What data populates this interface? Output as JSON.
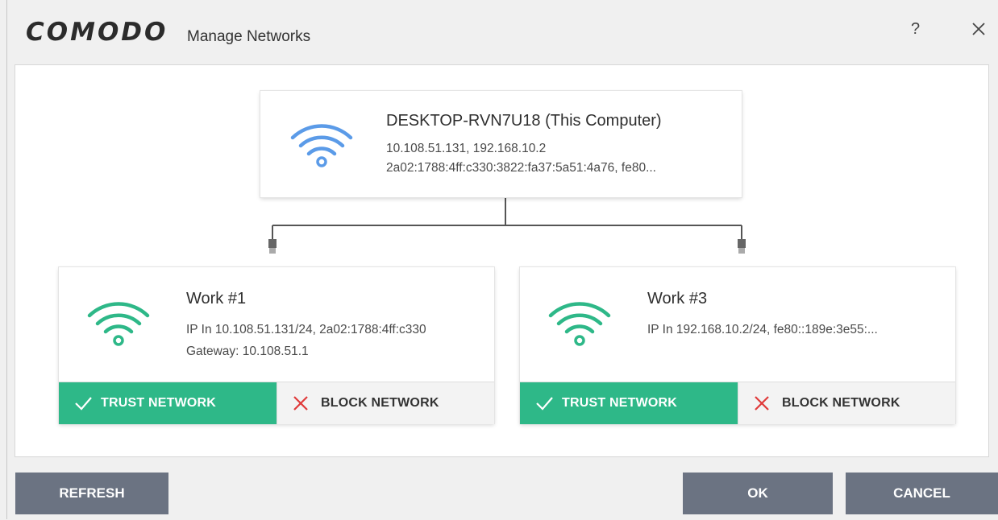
{
  "window": {
    "logo": "COMODO",
    "title": "Manage Networks",
    "help": "?"
  },
  "computer": {
    "name": "DESKTOP-RVN7U18 (This Computer)",
    "ipv4": "10.108.51.131, 192.168.10.2",
    "ipv6": "2a02:1788:4ff:c330:3822:fa37:5a51:4a76, fe80...",
    "icon": "wifi-icon",
    "icon_color": "#5b9be8"
  },
  "networks": [
    {
      "name": "Work #1",
      "ip": "IP In 10.108.51.131/24, 2a02:1788:4ff:c330",
      "gateway": "Gateway: 10.108.51.1",
      "trust_label": "TRUST NETWORK",
      "block_label": "BLOCK NETWORK",
      "icon": "wifi-icon"
    },
    {
      "name": "Work #3",
      "ip": "IP In 192.168.10.2/24, fe80::189e:3e55:...",
      "trust_label": "TRUST NETWORK",
      "block_label": "BLOCK NETWORK",
      "icon": "wifi-icon"
    }
  ],
  "colors": {
    "trust": "#2eb888",
    "block_x": "#e03a3a",
    "network_icon": "#2eb888",
    "footer_button": "#6b7382"
  },
  "footer": {
    "refresh": "REFRESH",
    "ok": "OK",
    "cancel": "CANCEL"
  }
}
